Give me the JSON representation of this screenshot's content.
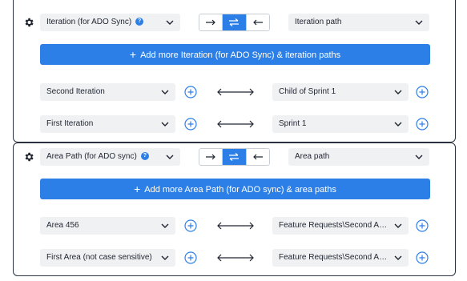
{
  "sections": [
    {
      "field_select": "Iteration (for ADO Sync)",
      "target_select": "Iteration path",
      "add_label": "Add more Iteration (for ADO Sync) & iteration paths",
      "rows": [
        {
          "left": "Second Iteration",
          "right": "Child of Sprint 1"
        },
        {
          "left": "First Iteration",
          "right": "Sprint 1"
        }
      ]
    },
    {
      "field_select": "Area Path (for ADO sync)",
      "target_select": "Area path",
      "add_label": "Add more Area Path (for ADO sync) & area paths",
      "rows": [
        {
          "left": "Area 456",
          "right": "Feature Requests\\Second Area ..."
        },
        {
          "left": "First Area (not case sensitive)",
          "right": "Feature Requests\\Second Area ..."
        }
      ]
    }
  ],
  "help_glyph": "?",
  "colors": {
    "accent": "#2d7fe8",
    "border": "#2c3140",
    "field_bg": "#f0f1f3"
  },
  "icons": {
    "gear": "gear-icon",
    "help": "help-icon",
    "dir_right": "arrow-right-icon",
    "dir_both": "arrows-exchange-icon",
    "dir_left": "arrow-left-icon",
    "add_row": "circle-plus-icon",
    "mapping": "double-arrow-icon",
    "chevron": "chevron-down-icon"
  }
}
